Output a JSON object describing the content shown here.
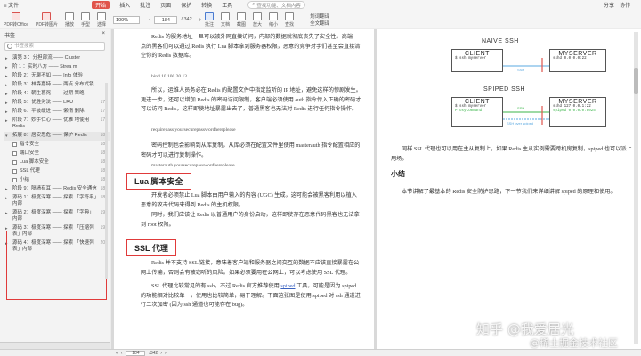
{
  "menu": {
    "items": [
      "≡ 文件",
      "",
      "",
      "",
      "",
      "",
      "",
      "",
      "",
      "",
      "",
      "开始",
      "插入",
      "批注",
      "页面",
      "保护",
      "转换",
      "工具"
    ],
    "search": "查找功能、文档内容",
    "right": [
      "分享",
      "协作"
    ]
  },
  "toolbar": {
    "buttons": [
      {
        "label": "PDF转Office",
        "kind": "red"
      },
      {
        "label": "PDF转图片",
        "kind": "red"
      },
      {
        "label": "播放",
        "kind": "plain"
      },
      {
        "label": "手型",
        "kind": "plain"
      },
      {
        "label": "选择",
        "kind": "plain"
      }
    ],
    "zoom": "100%",
    "page_current": "184",
    "page_total": "/ 342",
    "translate": [
      "划词翻译",
      "全文翻译"
    ],
    "tools": [
      "批注",
      "文档",
      "截图",
      "放大",
      "缩小",
      "查找"
    ]
  },
  "sidebar": {
    "title": "书签",
    "search_placeholder": "书签搜索",
    "items": [
      {
        "label": "演第 3 ：分担部流 —— Cluster",
        "page": "",
        "open": false
      },
      {
        "label": "阶 1 ：实时八方 —— Strea m",
        "page": "",
        "open": false
      },
      {
        "label": "阶段 2：无聊不如 —— Info 体验",
        "page": "",
        "open": false
      },
      {
        "label": "阶段 3：林森嘉特 —— 两点 分布式锁",
        "page": "",
        "open": false
      },
      {
        "label": "阶段 4：朝生暮死 —— 过期 策略",
        "page": "",
        "open": false
      },
      {
        "label": "阶段 5：优胜劣汰 —— LRU",
        "page": "170",
        "open": false
      },
      {
        "label": "阶段 6：平波缓进 —— 懒惰 删除",
        "page": "171",
        "open": false
      },
      {
        "label": "阶段 7：妙手仁心 —— 优雅 地使用 Redis",
        "page": "176",
        "open": false
      }
    ],
    "active": {
      "label": "拓展 8：居安思危 —— 保护 Redis",
      "page": "181"
    },
    "subitems": [
      {
        "label": "指令安全",
        "page": "182"
      },
      {
        "label": "端口安全",
        "page": "182"
      },
      {
        "label": "Lua 脚本安全",
        "page": "183"
      },
      {
        "label": "SSL 代理",
        "page": "183"
      },
      {
        "label": "小结",
        "page": "184"
      }
    ],
    "after": [
      {
        "label": "阶段 9：隔墙有耳 —— Redis 安全通信",
        "page": "185"
      },
      {
        "label": "源码 1：极度深寒 —— 探索 「字符串」内部",
        "page": "189"
      },
      {
        "label": "源码 2：极度深寒 —— 探索 「字典」内部",
        "page": "192"
      },
      {
        "label": "源码 3：极度深寒 —— 探索 「压缩列表」内部",
        "page": "197"
      },
      {
        "label": "源码 4：极度深寒 —— 探索 「快速列表」内部",
        "page": "202"
      }
    ]
  },
  "doc": {
    "left": {
      "p1": "Redis 的服务地址一旦可以被外网直接访问，内部的数据就彻底丧失了安全性。高端一点的黑客们可以通过 Redis 执行 Lua 脚本拿到服务器权限，恶意的竞争对手们甚至会直接清空你的 Redis 数据库。",
      "code1": "bind 10.100.20.13",
      "p2": "所以，运维人员务必在 Redis 的配置文件中指定监听的 IP 地址，避免这样的惨剧发生。更进一步，还可以增加 Redis 的密码访问限制，客户端必须使用 auth 指令传入正确的密码才可以访问 Redis，这样即使地址暴露出去了，普通黑客也无法对 Redis 进行任何指令操作。",
      "code2": "requirepass yoursecurepasswordhereplease",
      "p3": "密码控制也会影响到从库复制，从库必须在配置文件里使用 masterauth 指令配置相应的密码才可以进行复制操作。",
      "code3": "masterauth yoursecurepasswordhereplease",
      "h1": "Lua 脚本安全",
      "p4": "开发者必须禁止 Lua 脚本由用户输入的内容 (UGC) 生成，这可能会被黑客利用以植入恶意的攻击代码来得到 Redis 的主机权限。",
      "p5": "同时，我们应该让 Redis 以普通用户的身份启动，这样即使存在恶意代码黑客也无法拿到 root 权限。",
      "h2": "SSL 代理",
      "p6": "Redis 并不支持 SSL 链接，意味着客户端和服务器之间交互的数据不应该直接暴露在公网上传输，否则会有被窃听的风险。如果必须要用在公网上，可以考虑使用 SSL 代理。",
      "p7_a": "SSL 代理比较常见的有 ssh，不过 Redis 官方推荐使用 ",
      "p7_link": "spiped",
      "p7_b": " 工具，可能是因为 spiped 的功能相对比较单一，使用也比较简单，易于理解。下面这张图是使用 spiped 对 ssh 通道进行二次加密 (因为 ssh 通道也可能存在 bug)。"
    },
    "right": {
      "diagram1": {
        "title": "NAIVE SSH",
        "client": "CLIENT",
        "client_cmd": "$ ssh myserver",
        "server": "MYSERVER",
        "server_cmd": "sshd 0.0.0.0:22",
        "link": "SSH"
      },
      "diagram2": {
        "title": "SPIPED SSH",
        "client": "CLIENT",
        "client_cmd": "$ ssh myserver",
        "client_sub": "ProxyCommand",
        "server": "MYSERVER",
        "server_cmd": "sshd 127.0.0.1:22",
        "server_sub": "spiped 0.0.0.0:8025",
        "link_top": "SSH",
        "link_bottom": "SSH over spiped"
      },
      "p1": "同样 SSL 代理也可以用在主从复制上，如果 Redis 主从实例需要跨机房复制，spiped 也可以派上用场。",
      "h": "小结",
      "p2": "本节讲解了最基本的 Redis 安全防护思路，下一节我们来详细讲解 spiped 的原理和使用。"
    }
  },
  "statusbar": {
    "page": "184",
    "total": "/342"
  },
  "watermark": {
    "line1": "知乎 @我爱居光",
    "line2": "@稀土掘金技术社区"
  },
  "colors": {
    "accent_red": "#e03a3a",
    "link_blue": "#3a62c0",
    "diagram_green": "#3bb54a",
    "diagram_red": "#e0544b",
    "diagram_blue": "#5aa8e0"
  }
}
